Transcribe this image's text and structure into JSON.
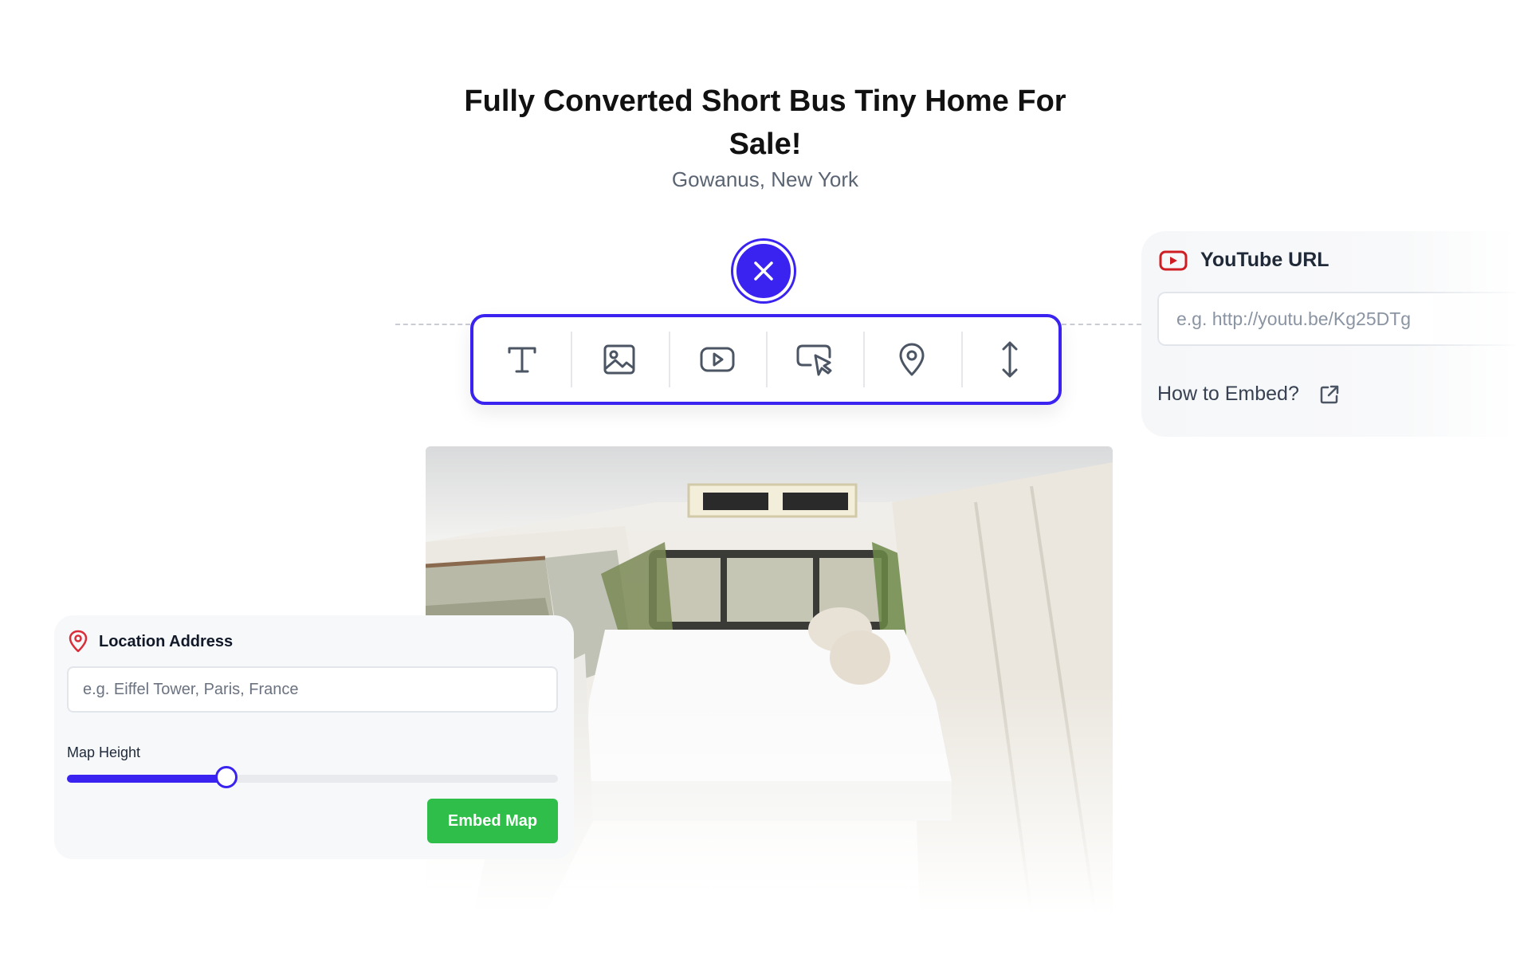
{
  "listing": {
    "title": "Fully Converted Short Bus Tiny Home For Sale!",
    "location": "Gowanus, New York"
  },
  "toolbar": {
    "tools": [
      {
        "icon": "text-icon"
      },
      {
        "icon": "image-icon"
      },
      {
        "icon": "video-icon"
      },
      {
        "icon": "button-click-icon"
      },
      {
        "icon": "map-pin-icon"
      },
      {
        "icon": "spacer-icon"
      }
    ],
    "close_icon": "close-icon"
  },
  "youtube": {
    "label": "YouTube URL",
    "placeholder": "e.g. http://youtu.be/Kg25DTg",
    "help_link": "How to Embed?"
  },
  "location_panel": {
    "label": "Location Address",
    "placeholder": "e.g. Eiffel Tower, Paris, France",
    "map_height_label": "Map Height",
    "map_height_fraction": 0.325,
    "embed_button": "Embed Map"
  },
  "colors": {
    "accent": "#3a23f0",
    "embed_green": "#2fbe49",
    "youtube_red": "#cf1d24",
    "pin_red": "#d92d3a"
  }
}
